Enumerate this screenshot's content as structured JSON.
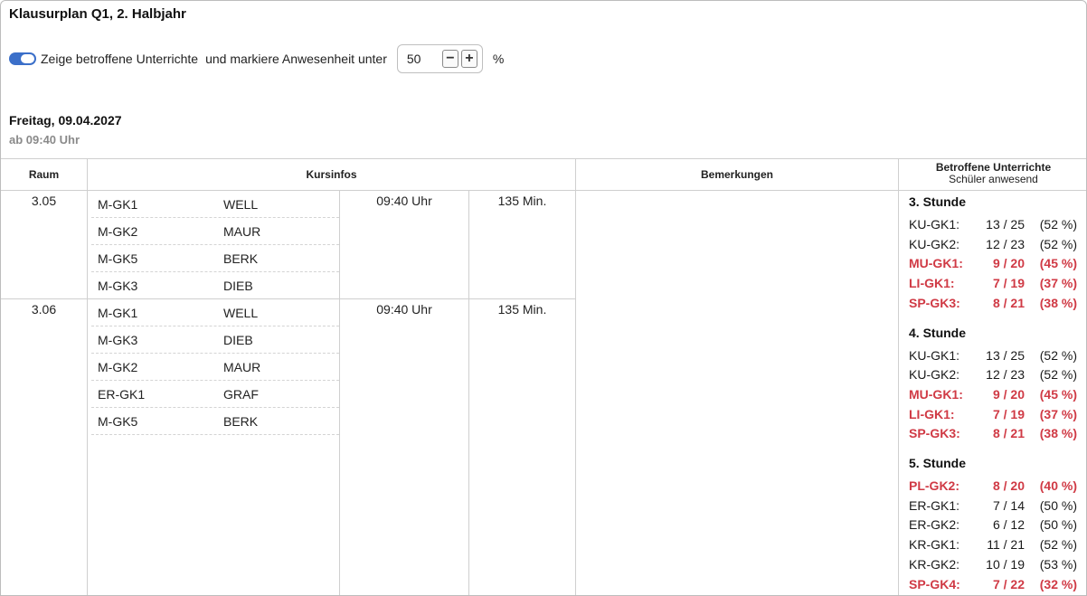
{
  "header": {
    "title": "Klausurplan Q1, 2. Halbjahr"
  },
  "controls": {
    "toggle_label": "Zeige betroffene Unterrichte",
    "threshold_text": "und markiere Anwesenheit unter",
    "threshold_value": "50",
    "minus": "−",
    "plus": "+",
    "unit": "%"
  },
  "day": {
    "date": "Freitag, 09.04.2027",
    "start": "ab 09:40 Uhr"
  },
  "table": {
    "headers": {
      "raum": "Raum",
      "kursinfos": "Kursinfos",
      "bemerkungen": "Bemerkungen",
      "betroffen": "Betroffene Unterrichte",
      "anwesend": "Schüler anwesend"
    },
    "rooms": [
      {
        "room": "3.05",
        "time": "09:40 Uhr",
        "duration": "135 Min.",
        "courses": [
          {
            "kurs": "M-GK1",
            "lehrer": "WELL"
          },
          {
            "kurs": "M-GK2",
            "lehrer": "MAUR"
          },
          {
            "kurs": "M-GK5",
            "lehrer": "BERK"
          },
          {
            "kurs": "M-GK3",
            "lehrer": "DIEB"
          }
        ]
      },
      {
        "room": "3.06",
        "time": "09:40 Uhr",
        "duration": "135 Min.",
        "courses": [
          {
            "kurs": "M-GK1",
            "lehrer": "WELL"
          },
          {
            "kurs": "M-GK3",
            "lehrer": "DIEB"
          },
          {
            "kurs": "M-GK2",
            "lehrer": "MAUR"
          },
          {
            "kurs": "ER-GK1",
            "lehrer": "GRAF"
          },
          {
            "kurs": "M-GK5",
            "lehrer": "BERK"
          }
        ]
      }
    ],
    "stunden": [
      {
        "title": "3. Stunde",
        "entries": [
          {
            "course": "KU-GK1:",
            "count": "13 / 25",
            "pct": "(52 %)",
            "low": false
          },
          {
            "course": "KU-GK2:",
            "count": "12 / 23",
            "pct": "(52 %)",
            "low": false
          },
          {
            "course": "MU-GK1:",
            "count": "9 / 20",
            "pct": "(45 %)",
            "low": true
          },
          {
            "course": "LI-GK1:",
            "count": "7 / 19",
            "pct": "(37 %)",
            "low": true
          },
          {
            "course": "SP-GK3:",
            "count": "8 / 21",
            "pct": "(38 %)",
            "low": true
          }
        ]
      },
      {
        "title": "4. Stunde",
        "entries": [
          {
            "course": "KU-GK1:",
            "count": "13 / 25",
            "pct": "(52 %)",
            "low": false
          },
          {
            "course": "KU-GK2:",
            "count": "12 / 23",
            "pct": "(52 %)",
            "low": false
          },
          {
            "course": "MU-GK1:",
            "count": "9 / 20",
            "pct": "(45 %)",
            "low": true
          },
          {
            "course": "LI-GK1:",
            "count": "7 / 19",
            "pct": "(37 %)",
            "low": true
          },
          {
            "course": "SP-GK3:",
            "count": "8 / 21",
            "pct": "(38 %)",
            "low": true
          }
        ]
      },
      {
        "title": "5. Stunde",
        "entries": [
          {
            "course": "PL-GK2:",
            "count": "8 / 20",
            "pct": "(40 %)",
            "low": true
          },
          {
            "course": "ER-GK1:",
            "count": "7 / 14",
            "pct": "(50 %)",
            "low": false
          },
          {
            "course": "ER-GK2:",
            "count": "6 / 12",
            "pct": "(50 %)",
            "low": false
          },
          {
            "course": "KR-GK1:",
            "count": "11 / 21",
            "pct": "(52 %)",
            "low": false
          },
          {
            "course": "KR-GK2:",
            "count": "10 / 19",
            "pct": "(53 %)",
            "low": false
          },
          {
            "course": "SP-GK4:",
            "count": "7 / 22",
            "pct": "(32 %)",
            "low": true
          }
        ]
      }
    ]
  },
  "colors": {
    "accent": "#3b6fc9",
    "warning": "#d03a45"
  }
}
